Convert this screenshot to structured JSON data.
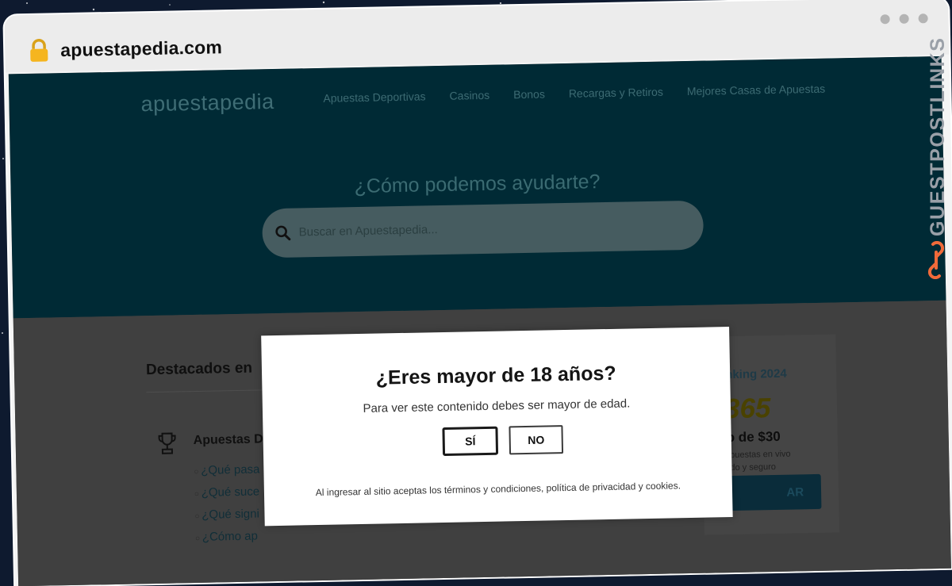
{
  "browser": {
    "url": "apuestapedia.com"
  },
  "site": {
    "logo": "apuestapedia",
    "nav": [
      {
        "label": "Apuestas Deportivas"
      },
      {
        "label": "Casinos"
      },
      {
        "label": "Bonos"
      },
      {
        "label": "Recargas y Retiros"
      },
      {
        "label": "Mejores Casas de Apuestas"
      }
    ],
    "hero_title": "¿Cómo podemos ayudarte?",
    "search_placeholder": "Buscar en Apuestapedia..."
  },
  "content": {
    "featured_heading": "Destacados en",
    "category_title": "Apuestas D",
    "questions": [
      "¿Qué pasa",
      "¿Qué suce",
      "¿Qué signi",
      "¿Cómo ap"
    ]
  },
  "sidebar": {
    "ranking_title": "nking 2024",
    "brand": "365",
    "bonus": "o de $30",
    "desc_line1": "puestas en vivo",
    "desc_line2": "do y seguro",
    "cta_label": "AR"
  },
  "modal": {
    "title": "¿Eres mayor de 18 años?",
    "text": "Para ver este contenido debes ser mayor de edad.",
    "yes_label": "SÍ",
    "no_label": "NO",
    "footer": "Al ingresar al sitio aceptas los términos y condiciones, política de privacidad y cookies."
  },
  "watermark": {
    "text": "GUESTPOSTLINKS"
  },
  "colors": {
    "hero_bg": "#002a35",
    "overlay_bg": "#404040",
    "watermark_accent": "#f06a3a"
  }
}
